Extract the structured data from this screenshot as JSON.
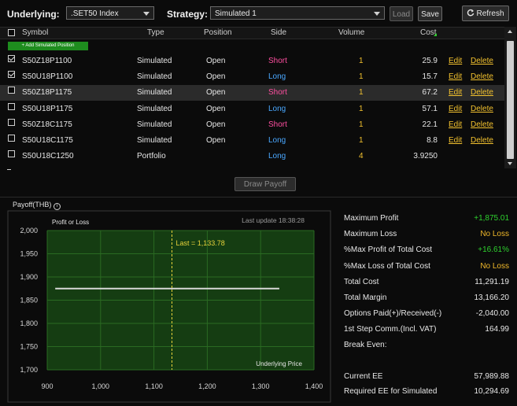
{
  "toolbar": {
    "underlying_label": "Underlying:",
    "underlying_value": ".SET50 Index",
    "strategy_label": "Strategy:",
    "strategy_value": "Simulated 1",
    "load_label": "Load",
    "save_label": "Save",
    "refresh_label": "Refresh"
  },
  "table": {
    "headers": {
      "symbol": "Symbol",
      "type": "Type",
      "position": "Position",
      "side": "Side",
      "volume": "Volume",
      "cost": "Cost"
    },
    "add_label": "+ Add Simulated Position",
    "edit_label": "Edit",
    "delete_label": "Delete",
    "rows": [
      {
        "checked": true,
        "symbol": "S50Z18P1100",
        "type": "Simulated",
        "position": "Open",
        "side": "Short",
        "volume": "1",
        "cost": "25.9"
      },
      {
        "checked": true,
        "symbol": "S50U18P1100",
        "type": "Simulated",
        "position": "Open",
        "side": "Long",
        "volume": "1",
        "cost": "15.7"
      },
      {
        "checked": false,
        "symbol": "S50Z18P1175",
        "type": "Simulated",
        "position": "Open",
        "side": "Short",
        "volume": "1",
        "cost": "67.2"
      },
      {
        "checked": false,
        "symbol": "S50U18P1175",
        "type": "Simulated",
        "position": "Open",
        "side": "Long",
        "volume": "1",
        "cost": "57.1"
      },
      {
        "checked": false,
        "symbol": "S50Z18C1175",
        "type": "Simulated",
        "position": "Open",
        "side": "Short",
        "volume": "1",
        "cost": "22.1"
      },
      {
        "checked": false,
        "symbol": "S50U18C1175",
        "type": "Simulated",
        "position": "Open",
        "side": "Long",
        "volume": "1",
        "cost": "8.8"
      },
      {
        "checked": false,
        "symbol": "S50U18C1250",
        "type": "Portfolio",
        "position": "",
        "side": "Long",
        "volume": "4",
        "cost": "3.9250"
      }
    ]
  },
  "draw_payoff_label": "Draw Payoff",
  "payoff": {
    "title": "Payoff(THB)",
    "chart_data": {
      "type": "line",
      "title": "",
      "ylabel": "Profit or Loss",
      "xlabel": "Underlying Price",
      "last_update": "Last update 18:38:28",
      "last_label": "Last = 1,133.78",
      "last_value": 1133.78,
      "xlim": [
        900,
        1400
      ],
      "ylim": [
        1700,
        2000
      ],
      "x_ticks": [
        "900",
        "1,000",
        "1,100",
        "1,200",
        "1,300",
        "1,400"
      ],
      "y_ticks": [
        "2,000",
        "1,950",
        "1,900",
        "1,850",
        "1,800",
        "1,750",
        "1,700"
      ],
      "series": [
        {
          "x": [
            915,
            1335
          ],
          "y": [
            1875.01,
            1875.01
          ]
        }
      ],
      "grid": true,
      "colors": {
        "plot_bg": "#153d12",
        "grid": "#2a6a22",
        "line": "#d8d8d8",
        "marker": "#e6d23a"
      }
    }
  },
  "stats": [
    {
      "label": "Maximum Profit",
      "value": "+1,875.01",
      "color": "green"
    },
    {
      "label": "Maximum Loss",
      "value": "No Loss",
      "color": "orange"
    },
    {
      "label": "%Max Profit of Total Cost",
      "value": "+16.61%",
      "color": "green"
    },
    {
      "label": "%Max Loss of Total Cost",
      "value": "No Loss",
      "color": "orange"
    },
    {
      "label": "Total Cost",
      "value": "11,291.19",
      "color": "white"
    },
    {
      "label": "Total Margin",
      "value": "13,166.20",
      "color": "white"
    },
    {
      "label": "Options Paid(+)/Received(-)",
      "value": "-2,040.00",
      "color": "white"
    },
    {
      "label": "1st Step Comm.(Incl. VAT)",
      "value": "164.99",
      "color": "white"
    },
    {
      "label": "Break Even:",
      "value": "",
      "color": "white"
    }
  ],
  "ee": [
    {
      "label": "Current EE",
      "value": "57,989.88"
    },
    {
      "label": "Required EE for Simulated",
      "value": "10,294.69"
    }
  ]
}
